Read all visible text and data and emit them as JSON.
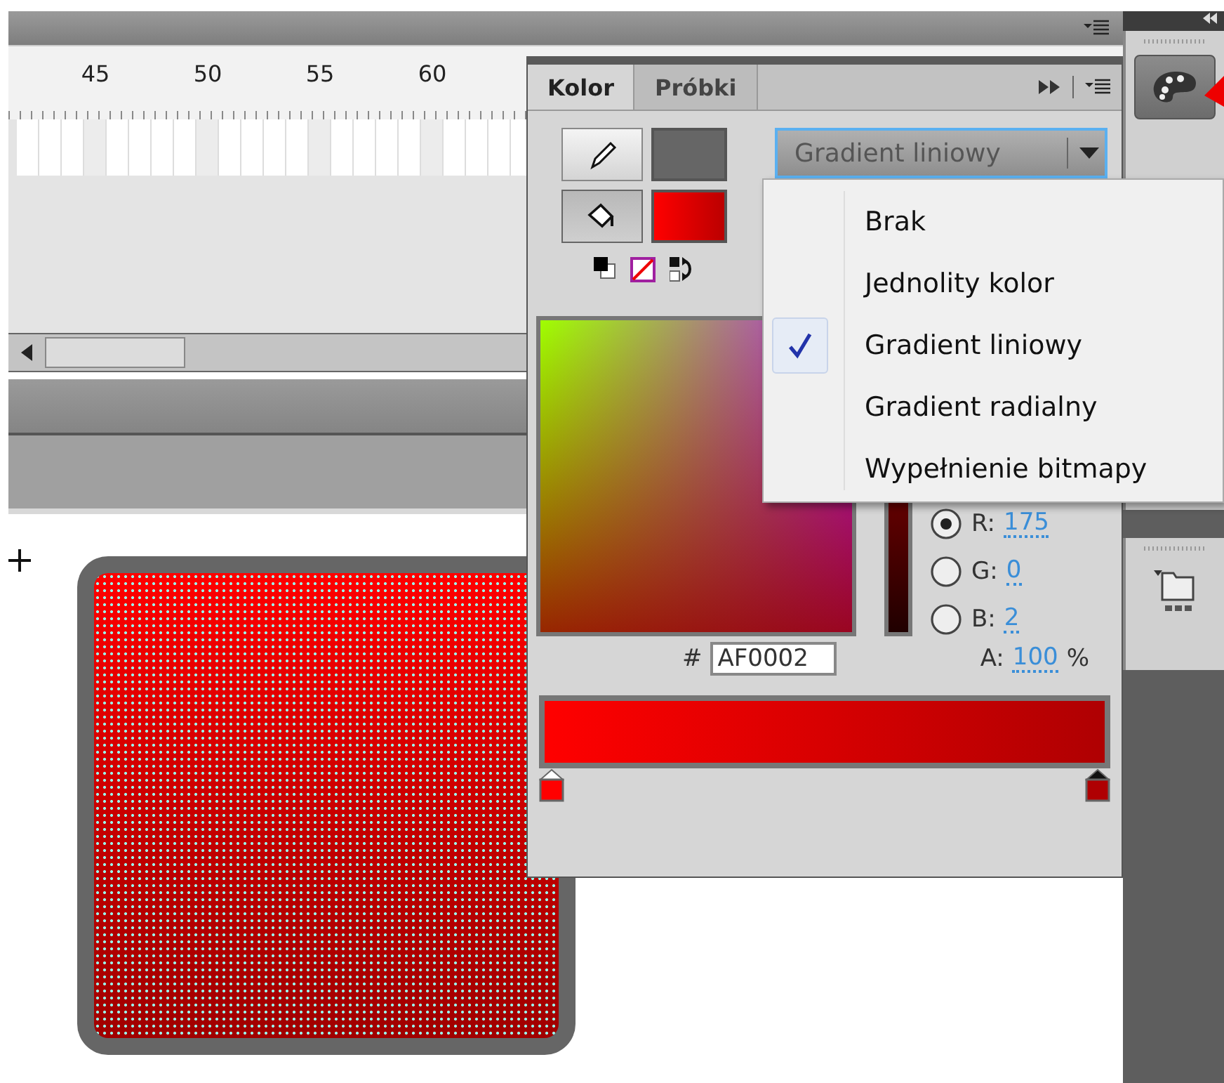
{
  "timeline": {
    "ruler_labels": [
      "45",
      "50",
      "55",
      "60"
    ]
  },
  "color_panel": {
    "tabs": [
      {
        "label": "Kolor",
        "selected": true
      },
      {
        "label": "Próbki",
        "selected": false
      }
    ],
    "swatches": [
      {
        "kind": "stroke",
        "selected": false
      },
      {
        "kind": "fill",
        "selected": true
      }
    ],
    "fill_type": {
      "value": "Gradient liniowy",
      "expanded": true
    },
    "fill_type_menu": [
      {
        "label": "Brak",
        "checked": false
      },
      {
        "label": "Jednolity kolor",
        "checked": false
      },
      {
        "label": "Gradient liniowy",
        "checked": true
      },
      {
        "label": "Gradient radialny",
        "checked": false
      },
      {
        "label": "Wypełnienie bitmapy",
        "checked": false
      }
    ],
    "channels": [
      {
        "label": "R:",
        "value": "175",
        "selected": true
      },
      {
        "label": "G:",
        "value": "0",
        "selected": false
      },
      {
        "label": "B:",
        "value": "2",
        "selected": false
      }
    ],
    "alpha": {
      "label": "A:",
      "value": "100",
      "unit": "%"
    },
    "hex": {
      "prefix": "#",
      "value": "AF0002"
    },
    "gradient_stops": [
      {
        "color": "#ff0000",
        "selected": false
      },
      {
        "color": "#af0002",
        "selected": true
      }
    ]
  }
}
